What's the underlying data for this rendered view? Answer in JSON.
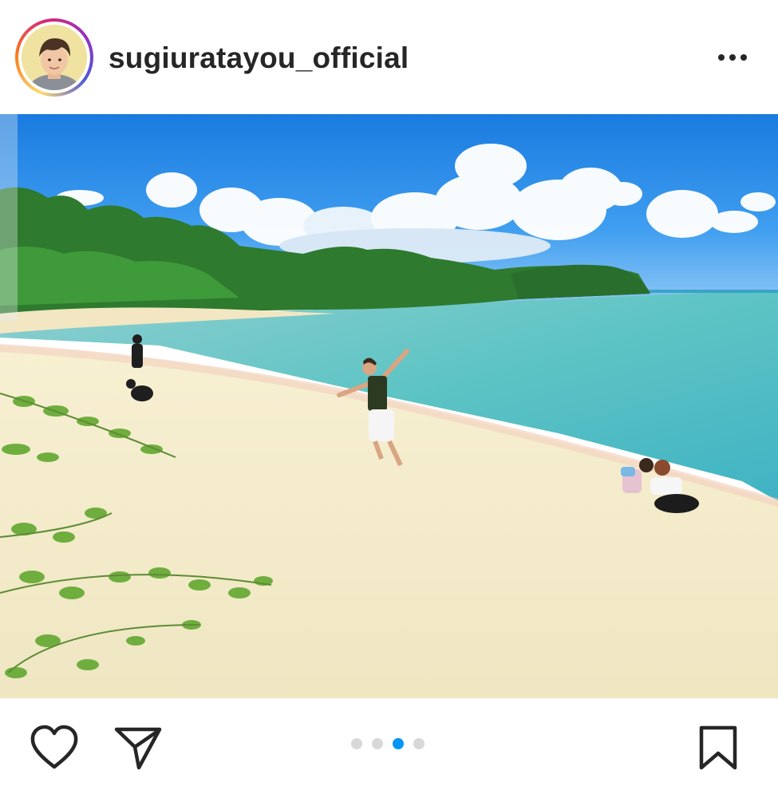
{
  "post": {
    "username": "sugiuratayou_official"
  },
  "header": {
    "avatar_icon": "profile-avatar",
    "more_icon": "more-horizontal-icon"
  },
  "carousel": {
    "total_slides": 4,
    "active_slide": 3,
    "active_color": "#0095f6",
    "inactive_color": "#d8d8d8"
  },
  "actions": {
    "like_icon": "heart-icon",
    "share_icon": "paper-plane-icon",
    "save_icon": "bookmark-icon"
  },
  "colors": {
    "sky": "#1e88e5",
    "sea": "#5cc3c0",
    "sand": "#f3ecc8",
    "foliage": "#2f7d32"
  }
}
